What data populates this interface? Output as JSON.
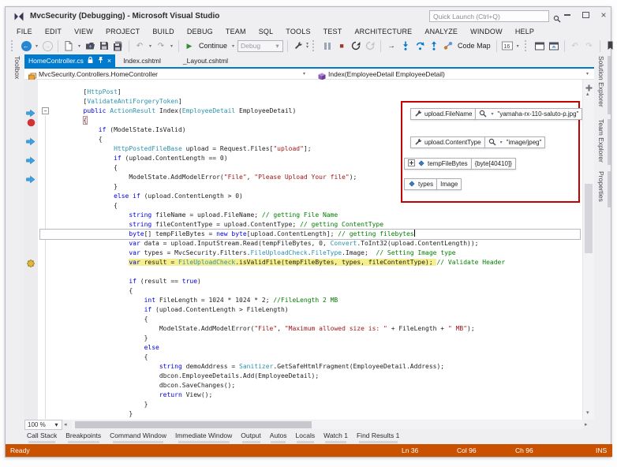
{
  "colors": {
    "accent_blue": "#007ACC",
    "status_debug_orange": "#CA5100",
    "breakpoint_red": "#D13438",
    "margin_arrow_blue": "#38A3E3",
    "current_statement_yellow": "#F6EF8E",
    "annotation_red": "#C40000",
    "syntax_keyword": "#0000E0",
    "syntax_type": "#2B91AF",
    "syntax_string": "#A31515",
    "syntax_comment": "#008000"
  },
  "title_bar": {
    "title": "MvcSecurity (Debugging) - Microsoft Visual Studio",
    "quick_launch": "Quick Launch (Ctrl+Q)",
    "icons": [
      "vs-logo-icon",
      "search-icon",
      "minimize-icon",
      "restore-icon",
      "close-icon"
    ]
  },
  "menu_bar": [
    "FILE",
    "EDIT",
    "VIEW",
    "PROJECT",
    "BUILD",
    "DEBUG",
    "TEAM",
    "SQL",
    "TOOLS",
    "TEST",
    "ARCHITECTURE",
    "ANALYZE",
    "WINDOW",
    "HELP"
  ],
  "toolbar": {
    "continue_label": "Continue",
    "debug_target": "Debug",
    "code_map_label": "Code Map",
    "icons": [
      "back-icon",
      "forward-icon",
      "new-file-icon",
      "open-file-icon",
      "save-icon",
      "save-all-icon",
      "undo-icon",
      "redo-icon",
      "continue-icon",
      "attach-icon",
      "break-all-icon",
      "stop-icon",
      "restart-icon",
      "show-next-statement-icon",
      "step-into-icon",
      "step-over-icon",
      "step-out-icon",
      "code-map-icon",
      "hex-display-icon",
      "breakpoints-window-icon",
      "threads-window-icon",
      "bookmark-icon"
    ]
  },
  "document_tabs": [
    {
      "label": "HomeController.cs",
      "active": true
    },
    {
      "label": "Index.cshtml",
      "active": false
    },
    {
      "label": "_Layout.cshtml",
      "active": false
    }
  ],
  "side_tabs": {
    "left": [
      "Toolbox"
    ],
    "right": [
      "Solution Explorer",
      "Team Explorer",
      "Properties"
    ]
  },
  "navigation_bar": {
    "left": "MvcSecurity.Controllers.HomeController",
    "right": "Index(EmployeeDetail EmployeeDetail)"
  },
  "editor": {
    "lines": [
      {
        "segs": [
          [
            "p",
            "        ["
          ],
          [
            "t",
            "HttpPost"
          ],
          [
            "p",
            "]"
          ]
        ]
      },
      {
        "segs": [
          [
            "p",
            "        ["
          ],
          [
            "t",
            "ValidateAntiForgeryToken"
          ],
          [
            "p",
            "]"
          ]
        ]
      },
      {
        "g": "arrow",
        "f": 1,
        "segs": [
          [
            "p",
            "        "
          ],
          [
            "k",
            "public"
          ],
          [
            "p",
            " "
          ],
          [
            "t",
            "ActionResult"
          ],
          [
            "p",
            " Index("
          ],
          [
            "t",
            "EmployeeDetail"
          ],
          [
            "p",
            " EmployeeDetail)"
          ]
        ]
      },
      {
        "g": "bp",
        "segs": [
          [
            "p",
            "        "
          ],
          [
            "b",
            "{"
          ]
        ]
      },
      {
        "segs": [
          [
            "p",
            "            "
          ],
          [
            "k",
            "if"
          ],
          [
            "p",
            " (ModelState.IsValid)"
          ]
        ]
      },
      {
        "g": "arrow",
        "segs": [
          [
            "p",
            "            {"
          ]
        ]
      },
      {
        "segs": [
          [
            "p",
            "                "
          ],
          [
            "t",
            "HttpPostedFileBase"
          ],
          [
            "p",
            " upload = Request.Files["
          ],
          [
            "s",
            "\"upload\""
          ],
          [
            "p",
            "];"
          ]
        ]
      },
      {
        "g": "arrow",
        "segs": [
          [
            "p",
            "                "
          ],
          [
            "k",
            "if"
          ],
          [
            "p",
            " (upload.ContentLength == 0)"
          ]
        ]
      },
      {
        "segs": [
          [
            "p",
            "                {"
          ]
        ]
      },
      {
        "g": "arrow",
        "segs": [
          [
            "p",
            "                    ModelState.AddModelError("
          ],
          [
            "s",
            "\"File\""
          ],
          [
            "p",
            ", "
          ],
          [
            "s",
            "\"Please Upload Your file\""
          ],
          [
            "p",
            ");"
          ]
        ]
      },
      {
        "segs": [
          [
            "p",
            "                }"
          ]
        ]
      },
      {
        "segs": [
          [
            "p",
            "                "
          ],
          [
            "k",
            "else"
          ],
          [
            "p",
            " "
          ],
          [
            "k",
            "if"
          ],
          [
            "p",
            " (upload.ContentLength > 0)"
          ]
        ]
      },
      {
        "segs": [
          [
            "p",
            "                {"
          ]
        ]
      },
      {
        "segs": [
          [
            "p",
            "                    "
          ],
          [
            "k",
            "string"
          ],
          [
            "p",
            " fileName = upload.FileName; "
          ],
          [
            "c",
            "// getting File Name"
          ]
        ]
      },
      {
        "segs": [
          [
            "p",
            "                    "
          ],
          [
            "k",
            "string"
          ],
          [
            "p",
            " fileContentType = upload.ContentType; "
          ],
          [
            "c",
            "// getting ContentType"
          ]
        ]
      },
      {
        "cur": 1,
        "segs": [
          [
            "p",
            "                    "
          ],
          [
            "k",
            "byte"
          ],
          [
            "p",
            "[] tempFileBytes = "
          ],
          [
            "k",
            "new"
          ],
          [
            "p",
            " "
          ],
          [
            "k",
            "byte"
          ],
          [
            "p",
            "[upload.ContentLength]; "
          ],
          [
            "c",
            "// getting filebytes"
          ],
          [
            "x",
            ""
          ]
        ]
      },
      {
        "segs": [
          [
            "p",
            "                    "
          ],
          [
            "k",
            "var"
          ],
          [
            "p",
            " data = upload.InputStream.Read(tempFileBytes, 0, "
          ],
          [
            "t",
            "Convert"
          ],
          [
            "p",
            ".ToInt32(upload.ContentLength));"
          ]
        ]
      },
      {
        "segs": [
          [
            "p",
            "                    "
          ],
          [
            "k",
            "var"
          ],
          [
            "p",
            " types = MvcSecurity.Filters."
          ],
          [
            "t",
            "FileUploadCheck"
          ],
          [
            "p",
            "."
          ],
          [
            "t",
            "FileType"
          ],
          [
            "p",
            ".Image;  "
          ],
          [
            "c",
            "// Setting Image type"
          ]
        ]
      },
      {
        "g": "star",
        "segs": [
          [
            "p",
            "                    "
          ],
          [
            "k",
            "var",
            1
          ],
          [
            "p",
            " result = ",
            1
          ],
          [
            "t",
            "FileUploadCheck",
            1
          ],
          [
            "p",
            ".isValidFile(tempFileBytes, types, fileContentType); ",
            1
          ],
          [
            "c",
            "// Validate Header"
          ]
        ]
      },
      {
        "segs": [
          [
            "p",
            ""
          ]
        ]
      },
      {
        "segs": [
          [
            "p",
            "                    "
          ],
          [
            "k",
            "if"
          ],
          [
            "p",
            " (result == "
          ],
          [
            "k",
            "true"
          ],
          [
            "p",
            ")"
          ]
        ]
      },
      {
        "segs": [
          [
            "p",
            "                    {"
          ]
        ]
      },
      {
        "segs": [
          [
            "p",
            "                        "
          ],
          [
            "k",
            "int"
          ],
          [
            "p",
            " FileLength = 1024 * 1024 * 2; "
          ],
          [
            "c",
            "//FileLength 2 MB"
          ]
        ]
      },
      {
        "segs": [
          [
            "p",
            "                        "
          ],
          [
            "k",
            "if"
          ],
          [
            "p",
            " (upload.ContentLength > FileLength)"
          ]
        ]
      },
      {
        "segs": [
          [
            "p",
            "                        {"
          ]
        ]
      },
      {
        "segs": [
          [
            "p",
            "                            ModelState.AddModelError("
          ],
          [
            "s",
            "\"File\""
          ],
          [
            "p",
            ", "
          ],
          [
            "s",
            "\"Maximum allowed size is: \""
          ],
          [
            "p",
            " + FileLength + "
          ],
          [
            "s",
            "\" MB\""
          ],
          [
            "p",
            ");"
          ]
        ]
      },
      {
        "segs": [
          [
            "p",
            "                        }"
          ]
        ]
      },
      {
        "segs": [
          [
            "p",
            "                        "
          ],
          [
            "k",
            "else"
          ]
        ]
      },
      {
        "segs": [
          [
            "p",
            "                        {"
          ]
        ]
      },
      {
        "segs": [
          [
            "p",
            "                            "
          ],
          [
            "k",
            "string"
          ],
          [
            "p",
            " demoAddress = "
          ],
          [
            "t",
            "Sanitizer"
          ],
          [
            "p",
            ".GetSafeHtmlFragment(EmployeeDetail.Address);"
          ]
        ]
      },
      {
        "segs": [
          [
            "p",
            "                            dbcon.EmployeeDetails.Add(EmployeeDetail);"
          ]
        ]
      },
      {
        "segs": [
          [
            "p",
            "                            dbcon.SaveChanges();"
          ]
        ]
      },
      {
        "segs": [
          [
            "p",
            "                            "
          ],
          [
            "k",
            "return"
          ],
          [
            "p",
            " View();"
          ]
        ]
      },
      {
        "segs": [
          [
            "p",
            "                        }"
          ]
        ]
      },
      {
        "segs": [
          [
            "p",
            "                    }"
          ]
        ]
      },
      {
        "segs": [
          [
            "p",
            "                }"
          ]
        ]
      }
    ]
  },
  "datatips": [
    {
      "icon": "wrench",
      "label": "upload.FileName",
      "visualizer": true,
      "value": "\"yamaha-rx-110-saluto-p.jpg\""
    },
    {
      "icon": "wrench",
      "label": "upload.ContentType",
      "visualizer": true,
      "value": "\"image/jpeg\""
    },
    {
      "icon": "diamond",
      "expander": true,
      "label": "tempFileBytes",
      "visualizer": false,
      "value": "{byte[40410]}"
    },
    {
      "icon": "diamond",
      "label": "types",
      "visualizer": false,
      "value": "Image"
    }
  ],
  "bottom": {
    "zoom_level": "100 %",
    "panel_tabs": [
      "Call Stack",
      "Breakpoints",
      "Command Window",
      "Immediate Window",
      "Output",
      "Autos",
      "Locals",
      "Watch 1",
      "Find Results 1"
    ],
    "status": {
      "ready": "Ready",
      "line": "Ln 36",
      "column": "Col 96",
      "character": "Ch 96",
      "mode": "INS"
    }
  }
}
